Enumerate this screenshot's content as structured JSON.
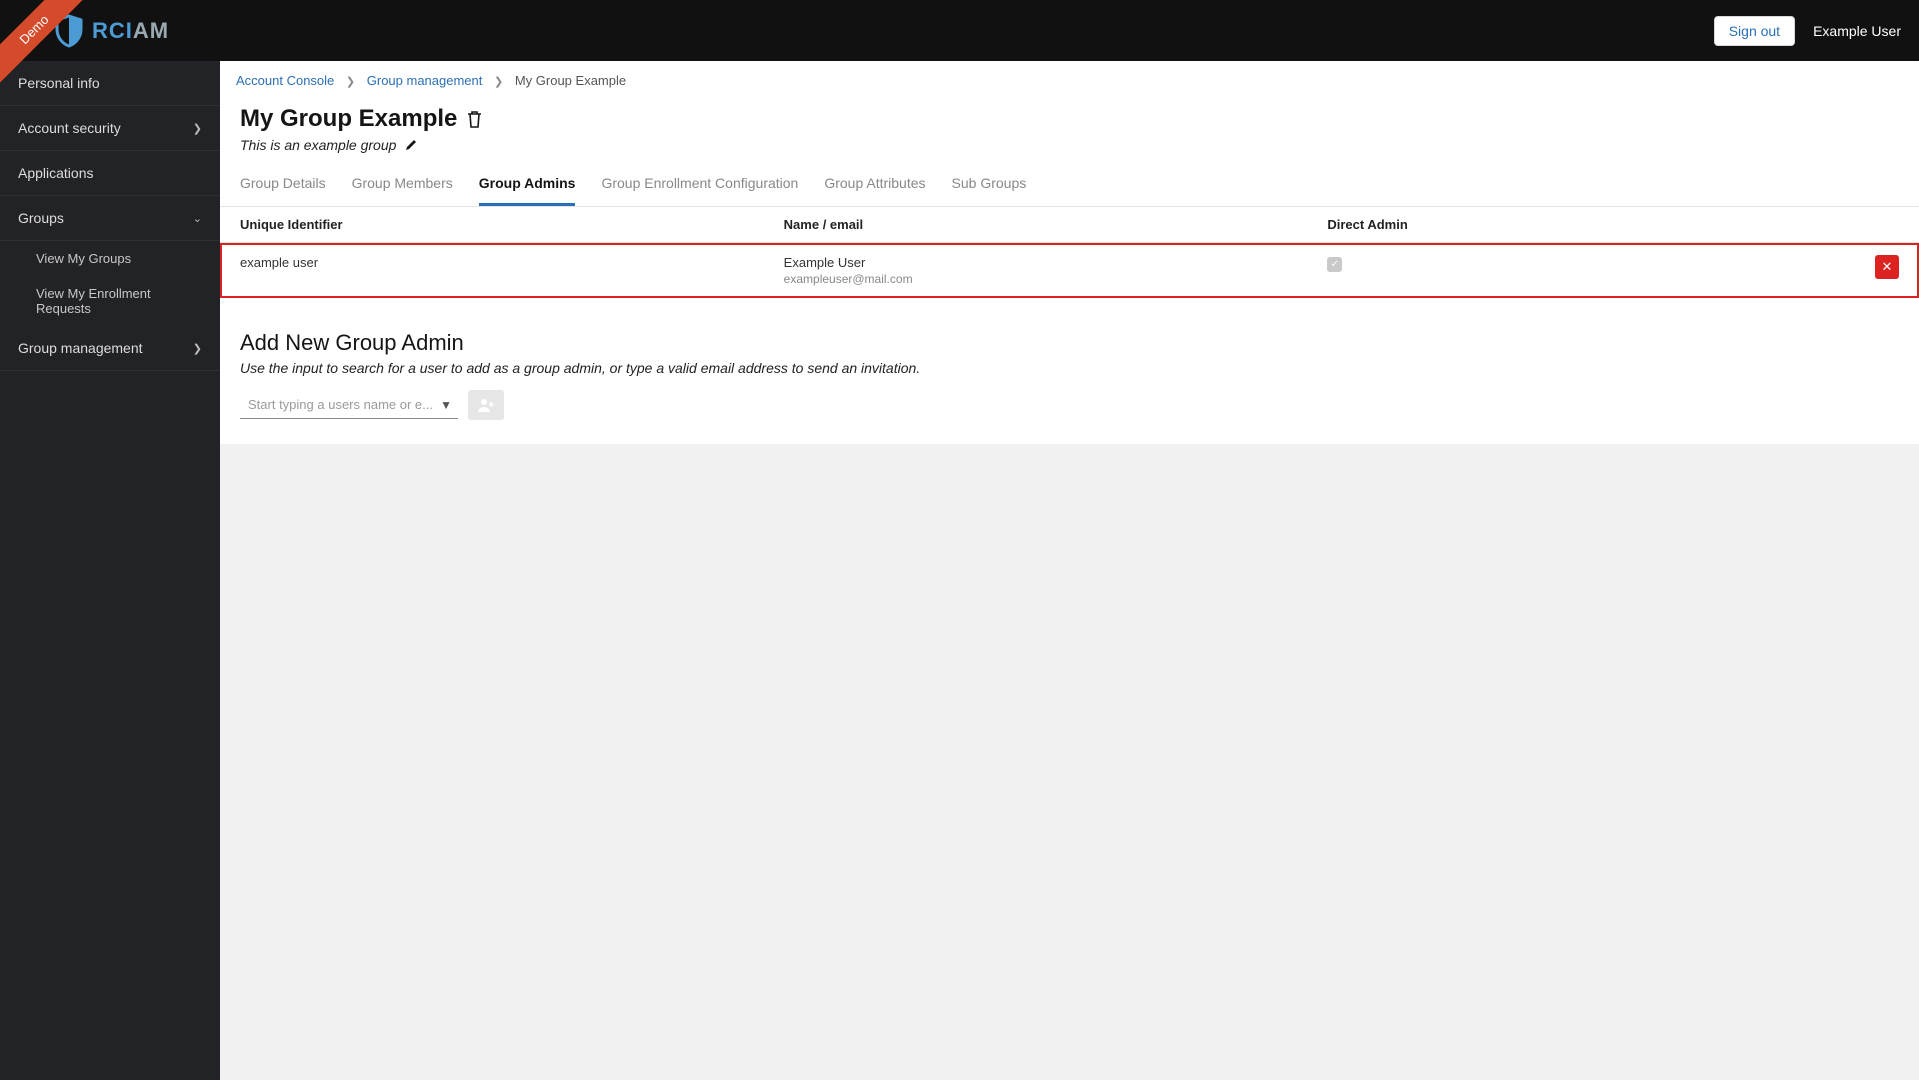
{
  "ribbon": "Demo",
  "logo": {
    "brand": "RCI",
    "suffix": "AM"
  },
  "header": {
    "sign_out": "Sign out",
    "user": "Example User"
  },
  "sidebar": {
    "personal_info": "Personal info",
    "account_security": "Account security",
    "applications": "Applications",
    "groups": "Groups",
    "view_my_groups": "View My Groups",
    "view_enrollment": "View My Enrollment Requests",
    "group_management": "Group management"
  },
  "breadcrumb": {
    "account_console": "Account Console",
    "group_management": "Group management",
    "current": "My Group Example"
  },
  "page": {
    "title": "My Group Example",
    "subtitle": "This is an example group"
  },
  "tabs": {
    "details": "Group Details",
    "members": "Group Members",
    "admins": "Group Admins",
    "enrollment": "Group Enrollment Configuration",
    "attributes": "Group Attributes",
    "subgroups": "Sub Groups"
  },
  "table": {
    "headers": {
      "uid": "Unique Identifier",
      "name": "Name / email",
      "direct": "Direct Admin"
    },
    "rows": [
      {
        "uid": "example user",
        "name": "Example User",
        "email": "exampleuser@mail.com",
        "direct": true
      }
    ]
  },
  "add": {
    "title": "Add New Group Admin",
    "desc": "Use the input to search for a user to add as a group admin, or type a valid email address to send an invitation.",
    "placeholder": "Start typing a users name or e..."
  }
}
